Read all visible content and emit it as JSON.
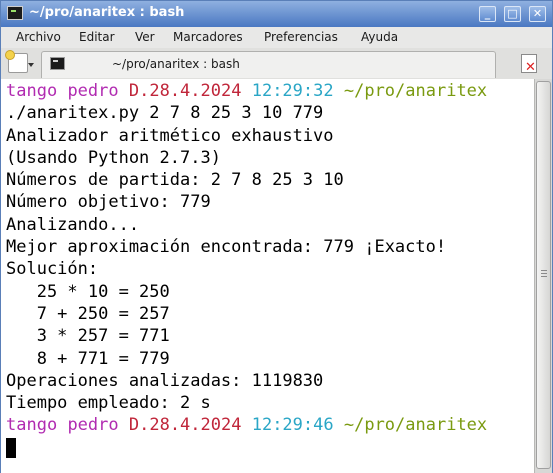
{
  "window": {
    "title": "~/pro/anaritex : bash",
    "controls": [
      "minimize",
      "maximize",
      "close"
    ]
  },
  "menu": [
    "Archivo",
    "Editar",
    "Ver",
    "Marcadores",
    "Preferencias",
    "Ayuda"
  ],
  "tab": {
    "label": "~/pro/anaritex : bash"
  },
  "prompt1": {
    "user": "tango",
    "host": "pedro",
    "date": "D.28.4.2024",
    "time": "12:29:32",
    "path": "~/pro/anaritex"
  },
  "command": "./anaritex.py 2 7 8 25 3 10 779",
  "output": [
    "Analizador aritmético exhaustivo",
    "(Usando Python 2.7.3)",
    "Números de partida: 2 7 8 25 3 10",
    "Número objetivo: 779",
    "Analizando...",
    "Mejor aproximación encontrada: 779 ¡Exacto!",
    "Solución:",
    "   25 * 10 = 250",
    "   7 + 250 = 257",
    "   3 * 257 = 771",
    "   8 + 771 = 779",
    "Operaciones analizadas: 1119830",
    "Tiempo empleado: 2 s"
  ],
  "prompt2": {
    "user": "tango",
    "host": "pedro",
    "date": "D.28.4.2024",
    "time": "12:29:46",
    "path": "~/pro/anaritex"
  },
  "colors": {
    "user": "#b12bb1",
    "host": "#b12bb1",
    "date": "#c0263a",
    "time": "#2aa6c6",
    "path": "#7a9a10",
    "titlebar": "#4a78c2"
  },
  "icons": {
    "app": "terminal-icon",
    "new_tab": "new-tab-icon",
    "tab": "terminal-icon",
    "close_tab": "close-tab-icon",
    "minimize": "minimize-icon",
    "maximize": "maximize-icon",
    "close": "close-icon"
  }
}
